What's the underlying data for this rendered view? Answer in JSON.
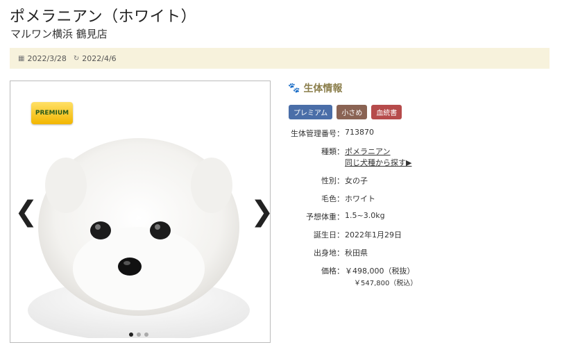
{
  "header": {
    "title": "ポメラニアン（ホワイト）",
    "shop": "マルワン横浜 鶴見店"
  },
  "dates": {
    "posted": "2022/3/28",
    "updated": "2022/4/6"
  },
  "gallery": {
    "badge": "PREMIUM",
    "prev": "❮",
    "next": "❯",
    "slide_count": 3,
    "active_slide": 1
  },
  "info": {
    "heading": "生体情報",
    "tags": [
      "プレミアム",
      "小さめ",
      "血統書"
    ],
    "tag_colors": [
      "#4a6ea8",
      "#8a6353",
      "#b64b4b"
    ],
    "accent": "#8a7d4a",
    "rows": {
      "id": {
        "label": "生体管理番号：",
        "value": "713870"
      },
      "breed": {
        "label": "種類：",
        "value": "ポメラニアン",
        "link2": "同じ犬種から探す▶"
      },
      "sex": {
        "label": "性別：",
        "value": "女の子"
      },
      "color": {
        "label": "毛色：",
        "value": "ホワイト"
      },
      "weight": {
        "label": "予想体重：",
        "value": "1.5~3.0kg"
      },
      "birthday": {
        "label": "誕生日：",
        "value": "2022年1月29日"
      },
      "origin": {
        "label": "出身地：",
        "value": "秋田県"
      },
      "price": {
        "label": "価格：",
        "value": "￥498,000（税抜）",
        "tax_in": "￥547,800（税込）"
      }
    }
  }
}
